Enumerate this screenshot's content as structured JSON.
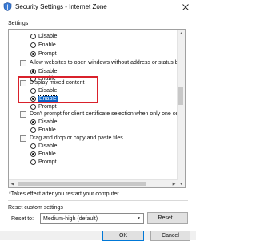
{
  "window": {
    "title": "Security Settings - Internet Zone",
    "close_icon": "close-icon"
  },
  "settings": {
    "label": "Settings",
    "rows": [
      {
        "kind": "option",
        "label": "Disable",
        "checked": false
      },
      {
        "kind": "option",
        "label": "Enable",
        "checked": false
      },
      {
        "kind": "option",
        "label": "Prompt",
        "checked": true
      },
      {
        "kind": "group",
        "label": "Allow websites to open windows without address or status b"
      },
      {
        "kind": "option",
        "label": "Disable",
        "checked": true
      },
      {
        "kind": "option",
        "label": "Enable",
        "checked": false
      },
      {
        "kind": "group",
        "label": "Display mixed content"
      },
      {
        "kind": "option",
        "label": "Disable",
        "checked": false
      },
      {
        "kind": "option",
        "label": "Enable",
        "checked": true,
        "selected": true
      },
      {
        "kind": "option",
        "label": "Prompt",
        "checked": false
      },
      {
        "kind": "group",
        "label": "Don't prompt for client certificate selection when only one ce"
      },
      {
        "kind": "option",
        "label": "Disable",
        "checked": true
      },
      {
        "kind": "option",
        "label": "Enable",
        "checked": false
      },
      {
        "kind": "group",
        "label": "Drag and drop or copy and paste files"
      },
      {
        "kind": "option",
        "label": "Disable",
        "checked": false
      },
      {
        "kind": "option",
        "label": "Enable",
        "checked": true
      },
      {
        "kind": "option",
        "label": "Prompt",
        "checked": false
      }
    ]
  },
  "note": "*Takes effect after you restart your computer",
  "reset": {
    "title": "Reset custom settings",
    "label": "Reset to:",
    "selected_value": "Medium-high (default)",
    "button": "Reset..."
  },
  "footer": {
    "ok": "OK",
    "cancel": "Cancel"
  },
  "colors": {
    "highlight_border": "#d9212b",
    "selection": "#0a64c8"
  }
}
